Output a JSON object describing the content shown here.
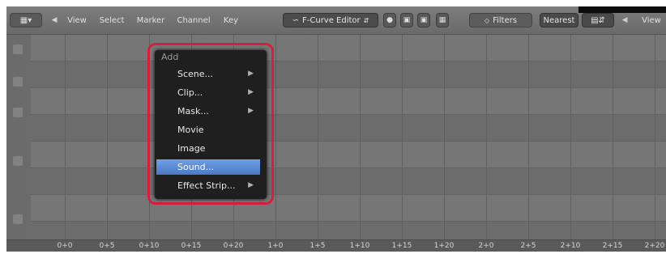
{
  "header": {
    "menus": [
      "View",
      "Select",
      "Marker",
      "Channel",
      "Key"
    ],
    "mode": "F-Curve Editor",
    "filters_label": "Filters",
    "nearest_label": "Nearest",
    "view_label": "View"
  },
  "add_menu": {
    "title": "Add",
    "items": [
      {
        "label": "Scene...",
        "submenu": true
      },
      {
        "label": "Clip...",
        "submenu": true
      },
      {
        "label": "Mask...",
        "submenu": true
      },
      {
        "label": "Movie",
        "submenu": false
      },
      {
        "label": "Image",
        "submenu": false
      },
      {
        "label": "Sound...",
        "submenu": false,
        "selected": true
      },
      {
        "label": "Effect Strip...",
        "submenu": true
      }
    ]
  },
  "ruler": {
    "ticks": [
      "0+0",
      "0+5",
      "0+10",
      "0+15",
      "0+20",
      "1+0",
      "1+5",
      "1+10",
      "1+15",
      "1+20",
      "2+0",
      "2+5",
      "2+10",
      "2+15",
      "2+20"
    ]
  },
  "colors": {
    "highlight": "#d42040",
    "selected_item": "#5b8ad6"
  }
}
